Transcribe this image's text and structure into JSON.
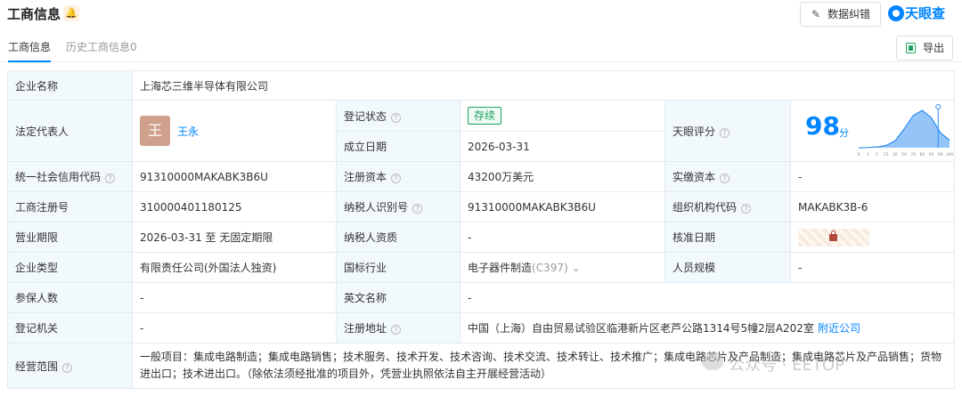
{
  "header": {
    "title": "工商信息",
    "bell_icon": "bell-icon",
    "report_button": "数据纠错",
    "logo_text": "天眼查"
  },
  "tabs": [
    {
      "label": "工商信息"
    },
    {
      "label": "历史工商信息0"
    }
  ],
  "export_button": "导出",
  "info": {
    "company_name_label": "企业名称",
    "company_name": "上海芯三维半导体有限公司",
    "legal_rep_label": "法定代表人",
    "legal_rep_avatar": "王",
    "legal_rep_name": "王永",
    "reg_status_label": "登记状态",
    "reg_status": "存续",
    "established_label": "成立日期",
    "established": "2026-03-31",
    "score_label": "天眼评分",
    "score": "98",
    "score_unit": "分",
    "credit_code_label": "统一社会信用代码",
    "credit_code": "91310000MAKABK3B6U",
    "reg_capital_label": "注册资本",
    "reg_capital": "43200万美元",
    "paid_capital_label": "实缴资本",
    "paid_capital": "-",
    "reg_no_label": "工商注册号",
    "reg_no": "310000401180125",
    "taxpayer_id_label": "纳税人识别号",
    "taxpayer_id": "91310000MAKABK3B6U",
    "org_code_label": "组织机构代码",
    "org_code": "MAKABK3B-6",
    "term_label": "营业期限",
    "term": "2026-03-31 至 无固定期限",
    "taxpayer_qual_label": "纳税人资质",
    "taxpayer_qual": "-",
    "approval_date_label": "核准日期",
    "company_type_label": "企业类型",
    "company_type": "有限责任公司(外国法人独资)",
    "industry_label": "国标行业",
    "industry": "电子器件制造",
    "industry_code": "(C397)",
    "staff_size_label": "人员规模",
    "staff_size": "-",
    "insured_label": "参保人数",
    "insured": "-",
    "english_name_label": "英文名称",
    "english_name": "-",
    "reg_authority_label": "登记机关",
    "reg_authority": "-",
    "address_label": "注册地址",
    "address": "中国（上海）自由贸易试验区临港新片区老芦公路1314号5幢2层A202室",
    "nearby_link": "附近公司",
    "scope_label": "经营范围",
    "scope": "一般项目：集成电路制造；集成电路销售；技术服务、技术开发、技术咨询、技术交流、技术转让、技术推广；集成电路芯片及产品制造；集成电路芯片及产品销售；货物进出口；技术进出口。（除依法须经批准的项目外，凭营业执照依法自主开展经营活动）"
  },
  "watermark": "公众号 · EETOP",
  "chart_data": {
    "type": "area",
    "x": [
      0,
      1,
      5,
      15,
      30,
      50,
      70,
      85,
      95,
      99,
      100
    ],
    "xtick_labels": [
      "0",
      "1",
      "5",
      "15",
      "30",
      "50",
      "70",
      "85",
      "95",
      "99",
      "100"
    ],
    "values": [
      0,
      0.5,
      2,
      6,
      18,
      50,
      86,
      100,
      80,
      40,
      20
    ],
    "marker_at": 98,
    "color": "#2B8CF0"
  }
}
